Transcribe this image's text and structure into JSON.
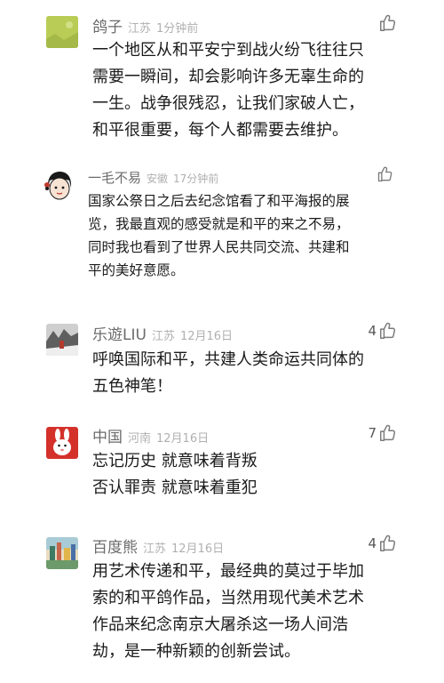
{
  "comments": [
    {
      "name": "鸽子",
      "location": "江苏",
      "time": "1分钟前",
      "likes": "",
      "text": "一个地区从和平安宁到战火纷飞往往只\n需要一瞬间，却会影响许多无辜生命的\n一生。战争很残忍，让我们家破人亡，\n和平很重要，每个人都需要去维护。",
      "avatar_color": "#b9cc55"
    },
    {
      "name": "一毛不易",
      "location": "安徽",
      "time": "17分钟前",
      "likes": "",
      "text": "国家公祭日之后去纪念馆看了和平海报的展\n览，我最直观的感受就是和平的来之不易，\n同时我也看到了世界人民共同交流、共建和\n平的美好意愿。",
      "avatar_color": "#1a1a1a"
    },
    {
      "name": "乐遊LIU",
      "location": "江苏",
      "time": "12月16日",
      "likes": "4",
      "text": "呼唤国际和平，共建人类命运共同体的\n五色神笔！",
      "avatar_color": "#7a7a7a"
    },
    {
      "name": "中国",
      "location": "河南",
      "time": "12月16日",
      "likes": "7",
      "text": "忘记历史 就意味着背叛\n否认罪责 就意味着重犯",
      "avatar_color": "#d4312b"
    },
    {
      "name": "百度熊",
      "location": "江苏",
      "time": "12月16日",
      "likes": "4",
      "text": "用艺术传递和平，最经典的莫过于毕加\n索的和平鸽作品，当然用现代美术艺术\n作品来纪念南京大屠杀这一场人间浩\n劫，是一种新颖的创新尝试。",
      "avatar_color": "#8fb7a8"
    }
  ]
}
